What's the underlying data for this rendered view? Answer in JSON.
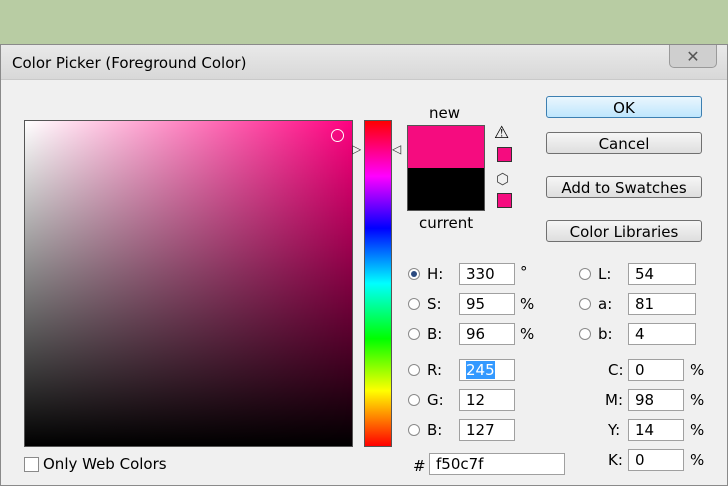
{
  "window": {
    "title": "Color Picker (Foreground Color)",
    "close": "✕"
  },
  "preview": {
    "new_label": "new",
    "current_label": "current",
    "new_color": "#f50c7f",
    "current_color": "#000000"
  },
  "buttons": {
    "ok": "OK",
    "cancel": "Cancel",
    "add_to_swatches": "Add to Swatches",
    "color_libraries": "Color Libraries"
  },
  "hsb": {
    "h": {
      "label": "H:",
      "value": "330",
      "unit": "°"
    },
    "s": {
      "label": "S:",
      "value": "95",
      "unit": "%"
    },
    "b": {
      "label": "B:",
      "value": "96",
      "unit": "%"
    }
  },
  "rgb": {
    "r": {
      "label": "R:",
      "value": "245"
    },
    "g": {
      "label": "G:",
      "value": "12"
    },
    "b": {
      "label": "B:",
      "value": "127"
    }
  },
  "lab": {
    "l": {
      "label": "L:",
      "value": "54"
    },
    "a": {
      "label": "a:",
      "value": "81"
    },
    "b": {
      "label": "b:",
      "value": "4"
    }
  },
  "cmyk": {
    "c": {
      "label": "C:",
      "value": "0",
      "unit": "%"
    },
    "m": {
      "label": "M:",
      "value": "98",
      "unit": "%"
    },
    "y": {
      "label": "Y:",
      "value": "14",
      "unit": "%"
    },
    "k": {
      "label": "K:",
      "value": "0",
      "unit": "%"
    }
  },
  "hex": {
    "label": "#",
    "value": "f50c7f"
  },
  "web_colors": {
    "label": "Only Web Colors"
  },
  "icons": {
    "warning": "⚠",
    "cube": "⬡",
    "arrow_right": "▷",
    "arrow_left": "◁"
  }
}
